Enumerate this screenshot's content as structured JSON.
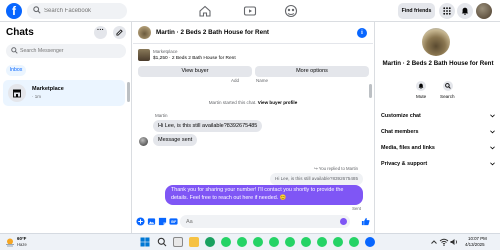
{
  "topbar": {
    "logo": "f",
    "search_placeholder": "Search Facebook",
    "find_friends": "Find friends"
  },
  "sidebar": {
    "title": "Chats",
    "more": "···",
    "search_placeholder": "Search Messenger",
    "filter": "Inbox",
    "items": [
      {
        "name": "Marketplace",
        "time": "· 1m"
      }
    ]
  },
  "conversation": {
    "title": "Martin · 2 Beds 2 Bath House for Rent",
    "listing": {
      "source": "Marketplace",
      "desc": "$1,250 · 2 Beds 2 Bath House for Rent"
    },
    "view_buyer": "View buyer",
    "more_options": "More options",
    "cut_add": "Add",
    "cut_name": "Name",
    "system_text": "Martin started this chat.",
    "system_link": "View buyer profile",
    "sender": "Martin",
    "incoming": [
      "Hi Lee, is this still available?8392675485",
      "Message sent"
    ],
    "replied_note": "You replied to Martin",
    "quoted": "Hi Lee, is this still available?8392675485",
    "outgoing": "Thank you for sharing your number! I'll contact you shortly to provide the details. Feel free to reach out here if needed. 😊",
    "sent_label": "Sent",
    "composer_placeholder": "Aa"
  },
  "info_panel": {
    "title": "Martin · 2 Beds 2 Bath House for Rent",
    "mute": "Mute",
    "search": "Search",
    "rows": [
      "Customize chat",
      "Chat members",
      "Media, files and links",
      "Privacy & support"
    ]
  },
  "taskbar": {
    "temp": "60°F",
    "condition": "Haze",
    "time": "10:07 PM",
    "date": "4/13/2025"
  },
  "colors": {
    "brand": "#0866ff",
    "outgoing_bubble": "#7f56f5",
    "incoming_bubble": "#e4e6eb"
  }
}
